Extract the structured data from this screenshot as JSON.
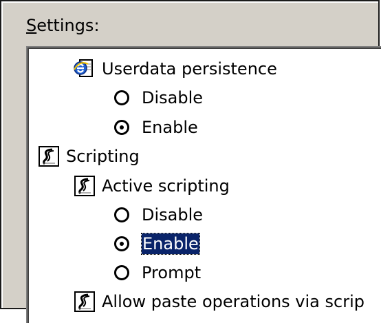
{
  "dialog": {
    "settings_accel": "S",
    "settings_rest": "ettings:"
  },
  "tree": {
    "userdata_persistence": "Userdata persistence",
    "ud_disable": "Disable",
    "ud_enable": "Enable",
    "scripting": "Scripting",
    "active_scripting": "Active scripting",
    "as_disable": "Disable",
    "as_enable": "Enable",
    "as_prompt": "Prompt",
    "allow_paste": "Allow paste operations via scrip"
  },
  "icons": {
    "userdata": "ie-e-icon",
    "scripting": "script-page-icon"
  },
  "colors": {
    "selection_bg": "#0a246a",
    "selection_fg": "#ffffff",
    "panel_bg": "#d4d0c8"
  }
}
